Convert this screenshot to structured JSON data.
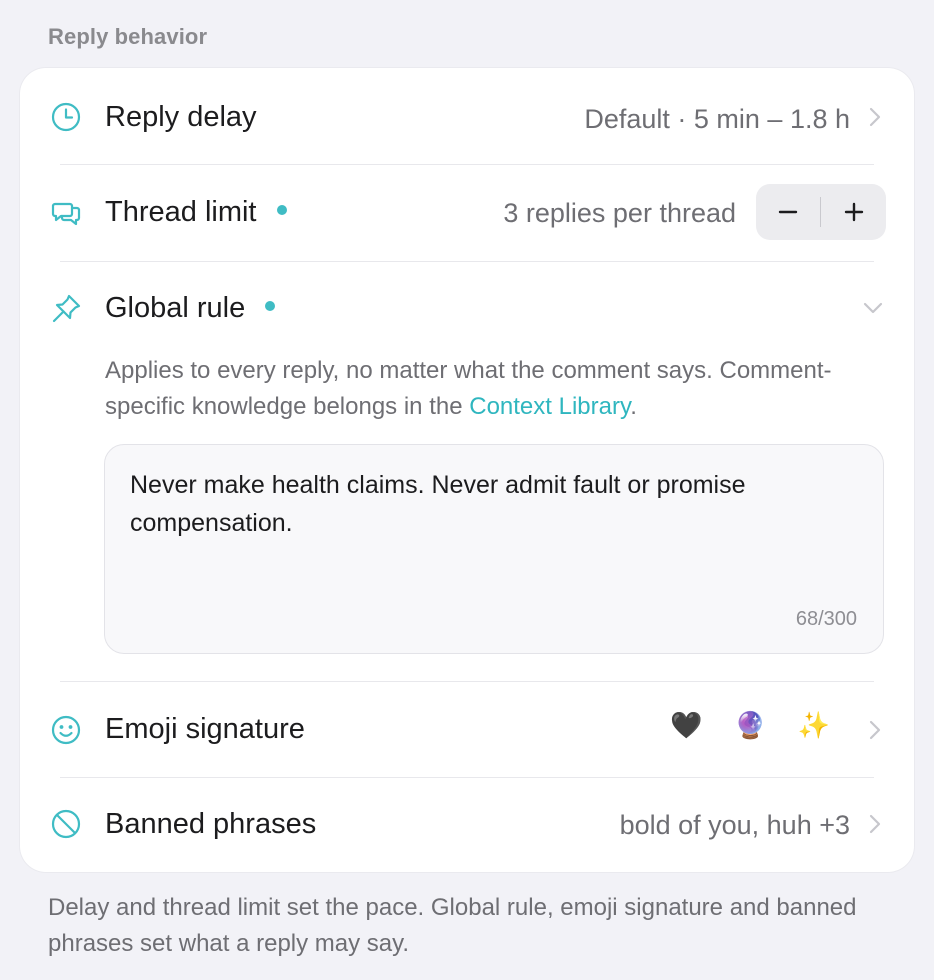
{
  "section_header": "Reply behavior",
  "rows": {
    "reply_delay": {
      "label": "Reply delay",
      "value": "Default · 5 min – 1.8 h",
      "icon": "clock-icon"
    },
    "thread_limit": {
      "label": "Thread limit",
      "value": "3 replies per thread",
      "icon": "chat-bubbles-icon",
      "stepper": {
        "minus": "−",
        "plus": "+"
      }
    },
    "global_rule": {
      "label": "Global rule",
      "icon": "pin-icon",
      "description_prefix": "Applies to every reply, no matter what the comment says. Comment-specific knowledge belongs in the ",
      "description_link": "Context Library",
      "description_suffix": ".",
      "rule_text": "Never make health claims. Never admit fault or promise compensation.",
      "counter": "68/300"
    },
    "emoji_signature": {
      "label": "Emoji signature",
      "value": "🖤 🔮 ✨",
      "icon": "smiley-icon"
    },
    "banned_phrases": {
      "label": "Banned phrases",
      "value": "bold of you, huh +3",
      "icon": "prohibited-icon"
    }
  },
  "footer": "Delay and thread limit set the pace. Global rule, emoji signature and banned phrases set what a reply may say.",
  "colors": {
    "accent": "#3fbcc4",
    "link": "#2fb6bf",
    "background": "#f2f2f7",
    "card": "#ffffff",
    "secondary_text": "#6e6e73"
  }
}
